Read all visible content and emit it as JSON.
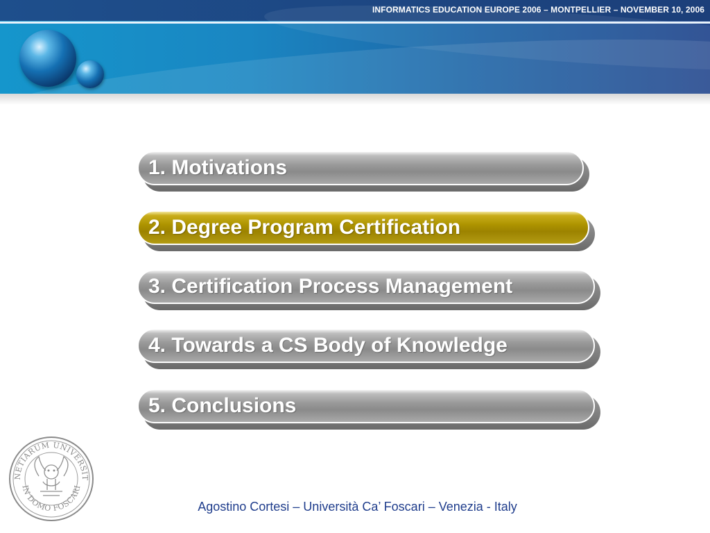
{
  "header": {
    "conference": "INFORMATICS EDUCATION EUROPE 2006 – MONTPELLIER – NOVEMBER 10, 2006"
  },
  "agenda": {
    "items": [
      {
        "label": "1. Motivations",
        "active": false
      },
      {
        "label": "2. Degree Program Certification",
        "active": true
      },
      {
        "label": "3. Certification Process Management",
        "active": false
      },
      {
        "label": "4. Towards a CS Body of Knowledge",
        "active": false
      },
      {
        "label": "5. Conclusions",
        "active": false
      }
    ]
  },
  "seal": {
    "top_text": "VENETIARUM UNIVERSITAS",
    "bottom_text": "IN DOMO FOSCARI"
  },
  "footer": {
    "author": "Agostino Cortesi – Università Ca’ Foscari – Venezia - Italy"
  },
  "colors": {
    "active_item": "#ae9400",
    "inactive_item": "#9a9a9a",
    "footer_text": "#1f3d8c"
  }
}
